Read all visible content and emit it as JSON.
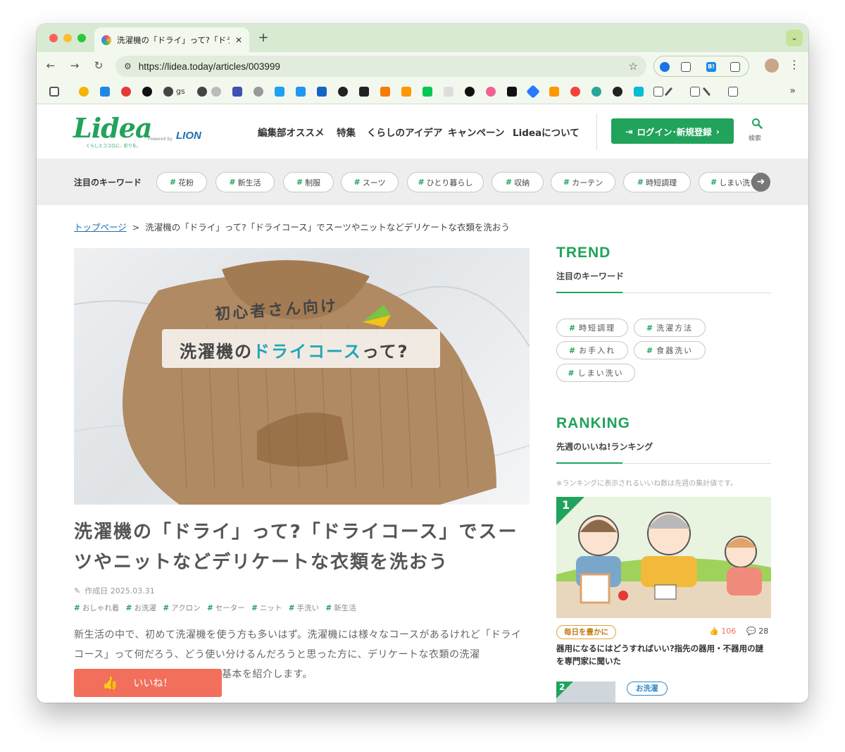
{
  "browser": {
    "tab_title": "洗濯機の「ドライ」って?「ドラ",
    "tab_close": "✕",
    "new_tab": "+",
    "url": "https://lidea.today/articles/003999",
    "bookmark_gs": "gs",
    "more": "»"
  },
  "site": {
    "logo": "Lidea",
    "logo_tagline": "くらしとココロに、彩りを。",
    "powered_by": "Powered by",
    "lion_logo": "LION",
    "nav": [
      "編集部オススメ",
      "特集",
      "くらしのアイデア",
      "キャンペーン",
      "Lideaについて"
    ],
    "login_label": "ログイン･新規登録",
    "login_arrow": "›",
    "search_label": "検索"
  },
  "keywords_bar": {
    "label": "注目のキーワード",
    "hash": "#",
    "chips": [
      "花粉",
      "新生活",
      "制服",
      "スーツ",
      "ひとり暮らし",
      "収納",
      "カーテン",
      "時短調理",
      "しまい洗い"
    ]
  },
  "breadcrumb": {
    "home": "トップページ",
    "sep": ">",
    "current": "洗濯機の「ドライ」って?「ドライコース」でスーツやニットなどデリケートな衣類を洗おう"
  },
  "article": {
    "hero_line1": "初心者さん向け",
    "hero_line2a": "洗濯機の",
    "hero_line2b": "ドライコース",
    "hero_line2c": "って?",
    "title": "洗濯機の「ドライ」って?「ドライコース」でスーツやニットなどデリケートな衣類を洗おう",
    "date_label": "作成日 2025.03.31",
    "tags": [
      "おしゃれ着",
      "お洗濯",
      "アクロン",
      "セーター",
      "ニット",
      "手洗い",
      "新生活"
    ],
    "body": "新生活の中で、初めて洗濯機を使う方も多いはず。洗濯機には様々なコースがあるけれど「ドライコース」って何だろう、どう使い分けるんだろうと思った方に、デリケートな衣類の洗濯",
    "body_tail": "基本を紹介します。",
    "like_label": "いいね！"
  },
  "sidebar": {
    "trend_en": "TREND",
    "trend_ja": "注目のキーワード",
    "trend_chips": [
      "時短調理",
      "洗濯方法",
      "お手入れ",
      "食器洗い",
      "しまい洗い"
    ],
    "ranking_en": "RANKING",
    "ranking_ja": "先週のいいね!ランキング",
    "ranking_note": "※ランキングに表示されるいいね数は先週の集計値です。",
    "rank1": {
      "num": "1",
      "category": "毎日を豊かに",
      "likes": "106",
      "comments": "28",
      "title": "器用になるにはどうすればいい?指先の器用・不器用の謎を専門家に聞いた"
    },
    "rank2": {
      "num": "2",
      "category": "お洗濯"
    }
  },
  "colors": {
    "brand_green": "#21a35b",
    "like_coral": "#f26f5b",
    "lion_blue": "#1f6fb2"
  }
}
